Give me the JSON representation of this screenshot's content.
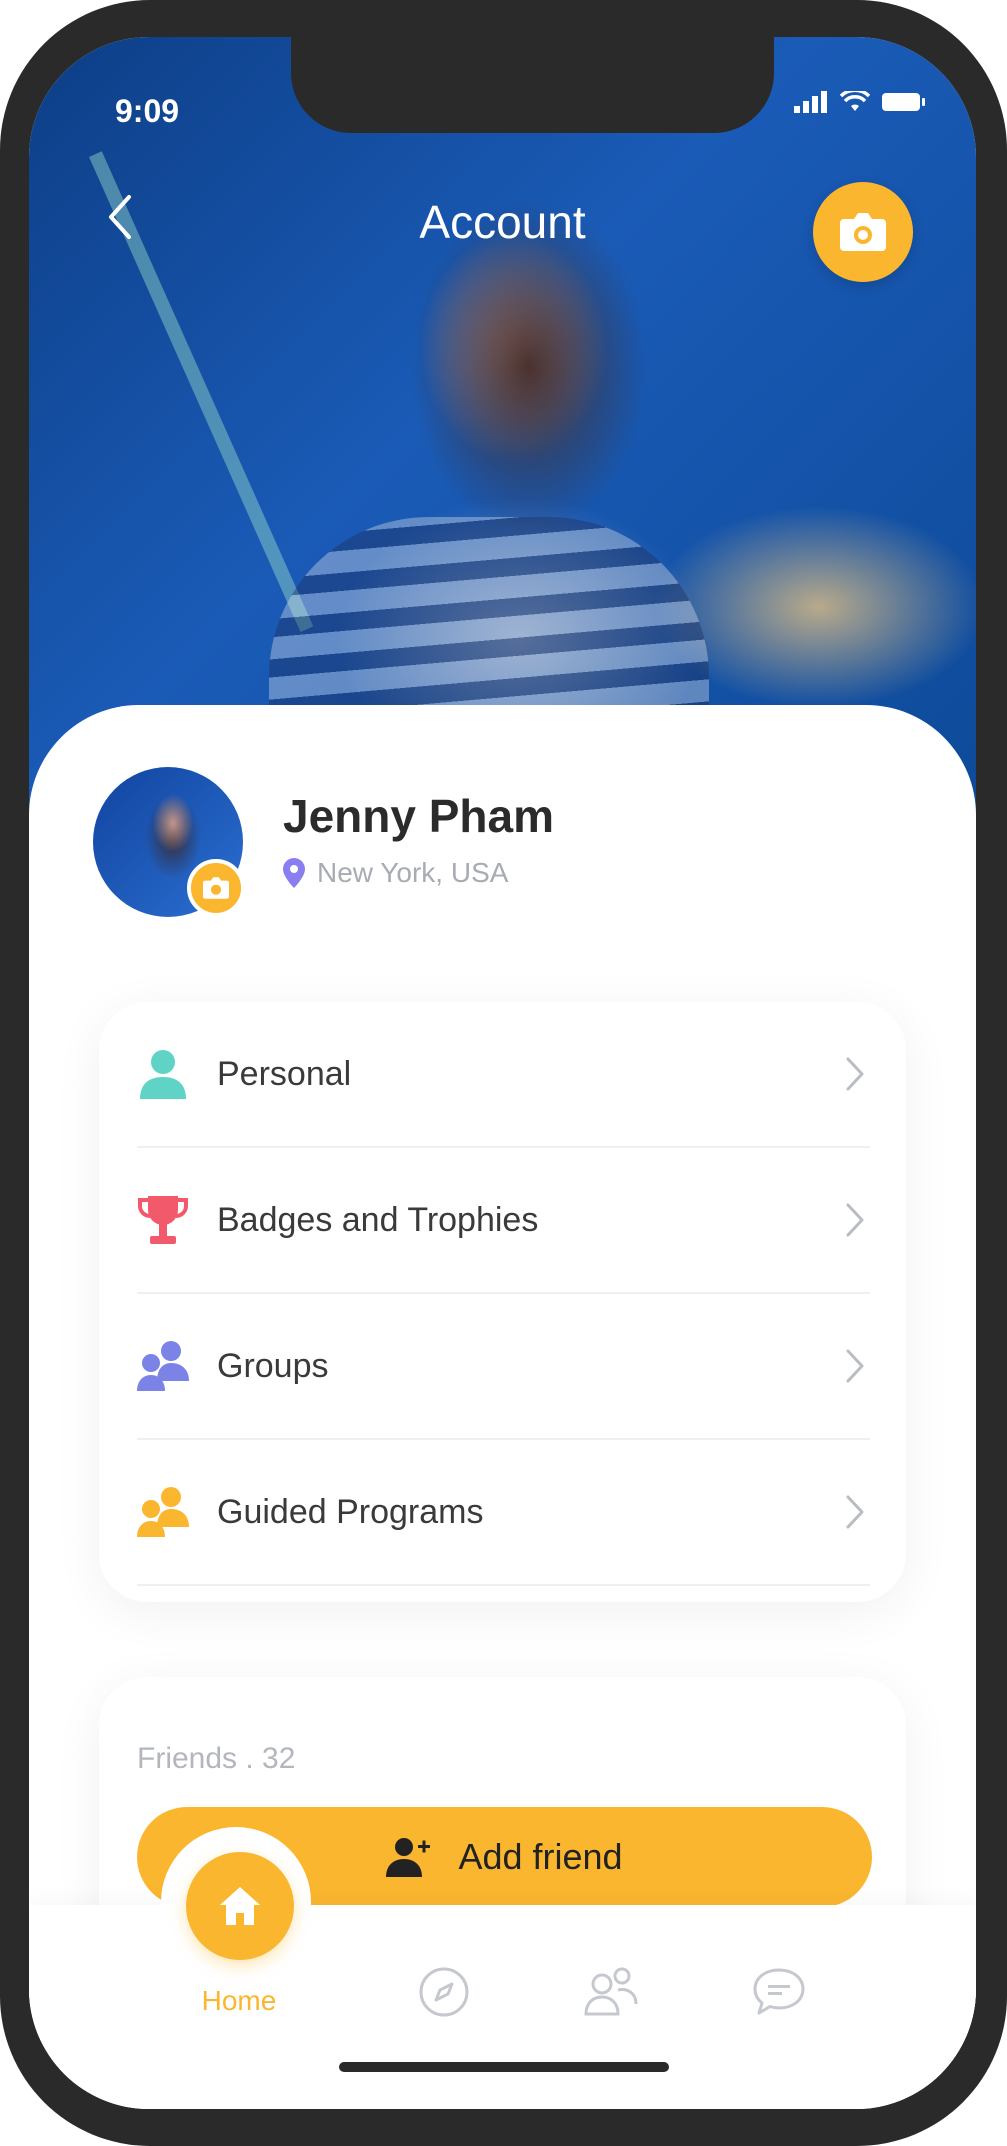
{
  "status_bar": {
    "time": "9:09"
  },
  "header": {
    "title": "Account"
  },
  "profile": {
    "name": "Jenny Pham",
    "location": "New York, USA"
  },
  "menu": {
    "items": [
      {
        "label": "Personal",
        "icon": "person-icon",
        "color": "#5fd3c6"
      },
      {
        "label": "Badges and Trophies",
        "icon": "trophy-icon",
        "color": "#f25a6b"
      },
      {
        "label": "Groups",
        "icon": "groups-icon",
        "color": "#7b83e6"
      },
      {
        "label": "Guided Programs",
        "icon": "guided-programs-icon",
        "color": "#fbb62f"
      }
    ]
  },
  "friends": {
    "count_text": "Friends . 32",
    "add_button": "Add friend"
  },
  "tabbar": {
    "home_label": "Home",
    "tabs": [
      "home-icon",
      "compass-icon",
      "friends-icon",
      "chat-icon"
    ]
  },
  "colors": {
    "accent": "#fbb62f",
    "text_dark": "#2b2b2b",
    "text_muted": "#a8abb3"
  }
}
